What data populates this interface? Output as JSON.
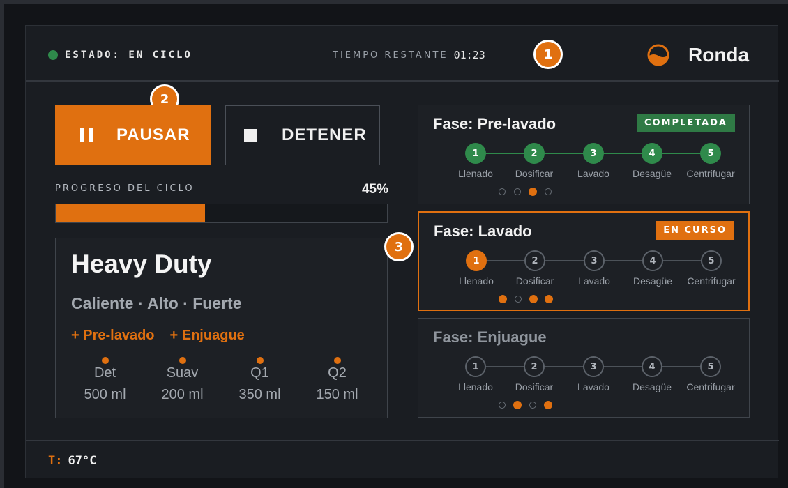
{
  "header": {
    "status_text": "ESTADO: EN CICLO",
    "status_color": "#2f8a4b",
    "timer_label": "TIEMPO RESTANTE",
    "timer_value": "01:23",
    "brand_name": "Ronda",
    "brand_icon": "half-filled-drum-icon"
  },
  "markers": [
    "1",
    "2",
    "3"
  ],
  "controls": {
    "pause_label": "PAUSAR",
    "pause_icon": "pause-icon",
    "stop_label": "DETENER",
    "stop_icon": "stop-icon"
  },
  "progress": {
    "label": "PROGRESO DEL CICLO",
    "percent_text": "45%",
    "value": 0.45
  },
  "program": {
    "name": "Heavy Duty",
    "settings": "Caliente · Alto · Fuerte",
    "options": [
      "+ Pre-lavado",
      "+ Enjuague"
    ],
    "dosing": [
      {
        "name": "Det",
        "amount": "500 ml"
      },
      {
        "name": "Suav",
        "amount": "200 ml"
      },
      {
        "name": "Q1",
        "amount": "350 ml"
      },
      {
        "name": "Q2",
        "amount": "150 ml"
      }
    ]
  },
  "step_labels": [
    "Llenado",
    "Dosificar",
    "Lavado",
    "Desagüe",
    "Centrifugar"
  ],
  "phases": [
    {
      "title": "Fase: Pre-lavado",
      "badge": "COMPLETADA",
      "state": "done",
      "steps": [
        "done",
        "done",
        "done",
        "done",
        "done"
      ],
      "dots": [
        false,
        false,
        true,
        false
      ]
    },
    {
      "title": "Fase: Lavado",
      "badge": "EN CURSO",
      "state": "active",
      "steps": [
        "current",
        "todo",
        "todo",
        "todo",
        "todo"
      ],
      "dots": [
        true,
        false,
        true,
        true
      ]
    },
    {
      "title": "Fase: Enjuague",
      "badge": "",
      "state": "dim",
      "steps": [
        "todo",
        "todo",
        "todo",
        "todo",
        "todo"
      ],
      "dots": [
        false,
        true,
        false,
        true
      ]
    }
  ],
  "footer": {
    "temp_key": "T:",
    "temp_value": "67°C"
  },
  "colors": {
    "accent": "#e07010",
    "success": "#2f8a4b",
    "background": "#1a1d22"
  }
}
